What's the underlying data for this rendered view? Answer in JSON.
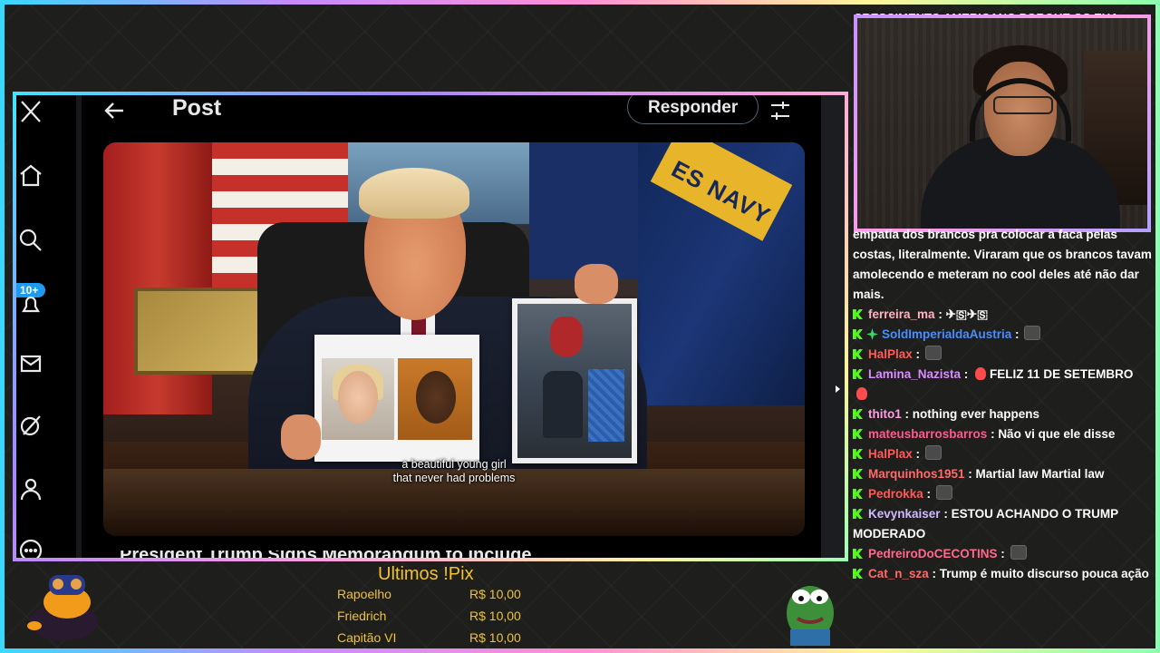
{
  "overlay": {
    "top_chat_text": "CRESCIMENTO AMERICANO PORQUE OS EUA"
  },
  "x_app": {
    "header": {
      "title": "Post",
      "reply_label": "Responder"
    },
    "sidebar": {
      "badge": "10+",
      "icons": [
        "x-logo-icon",
        "home-icon",
        "search-icon",
        "notifications-icon",
        "messages-icon",
        "grok-icon",
        "profile-icon",
        "more-icon"
      ]
    },
    "video": {
      "subtitle_line1": "a beautiful young girl",
      "subtitle_line2": "that never had problems",
      "navy_text": "ES NAVY"
    },
    "below_video_text": "President Trump Signs Memorandum to Include"
  },
  "chat": {
    "messages": [
      {
        "user": "",
        "color": "#ffffff",
        "text": "empatia dos brancos pra colocar a faca pelas costas, literalmente. Viraram que os brancos tavam amolecendo e meteram no cool deles até não dar mais.",
        "continuation": true
      },
      {
        "user": "ferreira_ma",
        "color": "#ffb3c1",
        "text": "✈🇸✈🇸"
      },
      {
        "user": "SoldImperialdaAustria",
        "color": "#4a8cff",
        "text": "",
        "emote": true,
        "sparkle": true
      },
      {
        "user": "HalPlax",
        "color": "#ff5a5a",
        "text": "",
        "emote": true
      },
      {
        "user": "Lamina_Nazista",
        "color": "#d98cff",
        "text": "FELIZ 11 DE SETEMBRO",
        "fire": true
      },
      {
        "user": "thito1",
        "color": "#ff9ee0",
        "text": "nothing ever happens"
      },
      {
        "user": "mateusbarrosbarros",
        "color": "#ff5a8c",
        "text": "Não vi que ele disse"
      },
      {
        "user": "HalPlax",
        "color": "#ff5a5a",
        "text": "",
        "emote": true
      },
      {
        "user": "Marquinhos1951",
        "color": "#ff6a6a",
        "text": "Martial law Martial law"
      },
      {
        "user": "Pedrokka",
        "color": "#ff5a5a",
        "text": "",
        "emote": true
      },
      {
        "user": "Kevynkaiser",
        "color": "#d0b8ff",
        "text": "ESTOU ACHANDO O TRUMP MODERADO"
      },
      {
        "user": "PedreiroDoCECOTINS",
        "color": "#ff6a8c",
        "text": "",
        "emote": true
      },
      {
        "user": "Cat_n_sza",
        "color": "#ff6a6a",
        "text": "Trump é muito discurso pouca ação"
      }
    ]
  },
  "pix": {
    "title": "Ultimos !Pix",
    "entries": [
      {
        "name": "Rapoelho",
        "value": "R$ 10,00"
      },
      {
        "name": "Friedrich",
        "value": "R$ 10,00"
      },
      {
        "name": "Capitão VI",
        "value": "R$ 10,00"
      }
    ]
  },
  "colors": {
    "kick_green": "#53fc18",
    "pix_gold": "#f2c230",
    "x_blue": "#1d9bf0"
  }
}
